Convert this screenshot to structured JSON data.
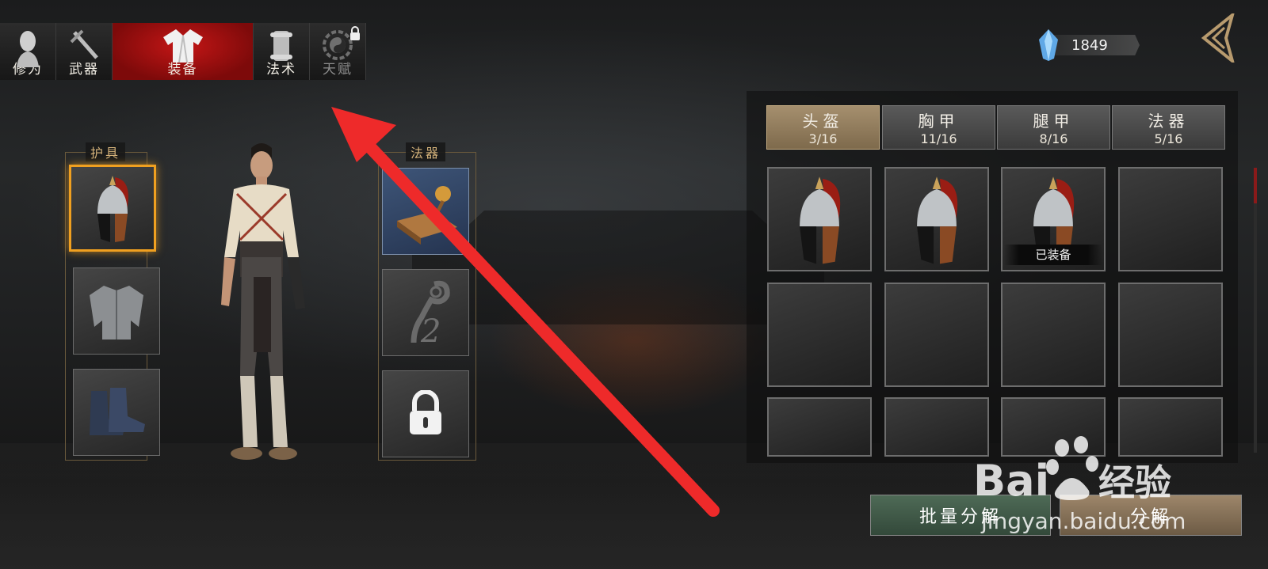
{
  "top_tabs": [
    {
      "label": "修为",
      "icon": "cultivation-head-icon",
      "active": false,
      "locked": false
    },
    {
      "label": "武器",
      "icon": "sword-icon",
      "active": false,
      "locked": false
    },
    {
      "label": "装备",
      "icon": "robe-icon",
      "active": true,
      "locked": false
    },
    {
      "label": "法术",
      "icon": "scroll-icon",
      "active": false,
      "locked": false
    },
    {
      "label": "天赋",
      "icon": "yin-yang-icon",
      "active": false,
      "locked": true
    }
  ],
  "currency": {
    "icon": "crystal-gem-icon",
    "amount": "1849"
  },
  "left_panel": {
    "armor_title": "护具",
    "artifact_title": "法器",
    "armor_slots": [
      {
        "name": "helmet",
        "icon": "helmet-icon",
        "selected": true
      },
      {
        "name": "chest",
        "icon": "chest-armor-icon",
        "selected": false
      },
      {
        "name": "boots",
        "icon": "boots-icon",
        "selected": false
      }
    ],
    "artifact_slots": [
      {
        "name": "seal",
        "icon": "seal-stamp-icon",
        "state": "equipped"
      },
      {
        "name": "slot-2",
        "icon": "ruyi-icon",
        "state": "empty",
        "number": "2"
      },
      {
        "name": "slot-3",
        "icon": "padlock-icon",
        "state": "locked"
      }
    ]
  },
  "category_tabs": [
    {
      "label": "头盔",
      "count": "3/16",
      "active": true
    },
    {
      "label": "胸甲",
      "count": "11/16",
      "active": false
    },
    {
      "label": "腿甲",
      "count": "8/16",
      "active": false
    },
    {
      "label": "法器",
      "count": "5/16",
      "active": false
    }
  ],
  "inventory": {
    "equipped_label": "已装备",
    "cells": [
      {
        "item": "helmet",
        "equipped": false
      },
      {
        "item": "helmet",
        "equipped": false
      },
      {
        "item": "helmet",
        "equipped": true
      },
      {
        "item": null
      },
      {
        "item": null
      },
      {
        "item": null
      },
      {
        "item": null
      },
      {
        "item": null
      },
      {
        "item": null
      },
      {
        "item": null
      },
      {
        "item": null
      },
      {
        "item": null
      }
    ]
  },
  "buttons": {
    "bulk_disassemble": "批量分解",
    "disassemble": "分解"
  },
  "colors": {
    "active_tab_red": "#c41616",
    "selected_gold": "#f0a020",
    "category_active": "#a58f6e",
    "arrow_red": "#ee2a2a"
  },
  "watermark": {
    "brand": "Bai",
    "brand_suffix": "经验",
    "url": "jingyan.baidu.com"
  }
}
